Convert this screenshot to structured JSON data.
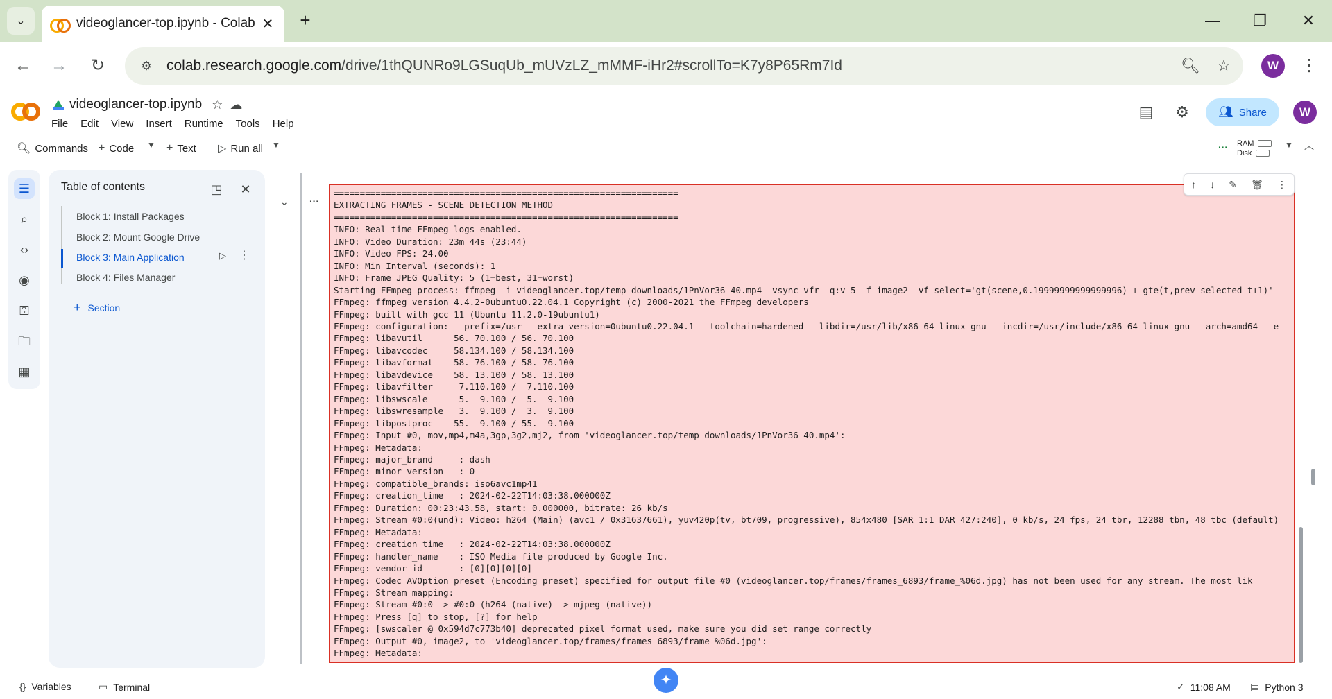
{
  "browser": {
    "tab_title": "videoglancer-top.ipynb - Colab",
    "url_host": "colab.research.google.com",
    "url_path": "/drive/1thQUNRo9LGSuqUb_mUVzLZ_mMMF-iHr2#scrollTo=K7y8P65Rm7Id",
    "profile_initial": "W"
  },
  "colab": {
    "notebook_title": "videoglancer-top.ipynb",
    "menu": [
      "File",
      "Edit",
      "View",
      "Insert",
      "Runtime",
      "Tools",
      "Help"
    ],
    "share_label": "Share",
    "avatar_initial": "W"
  },
  "cmdbar": {
    "commands_label": "Commands",
    "code_label": "Code",
    "text_label": "Text",
    "run_all_label": "Run all",
    "ram_label": "RAM",
    "disk_label": "Disk"
  },
  "toc": {
    "title": "Table of contents",
    "items": [
      {
        "label": "Block 1: Install Packages"
      },
      {
        "label": "Block 2: Mount Google Drive"
      },
      {
        "label": "Block 3: Main Application"
      },
      {
        "label": "Block 4: Files Manager"
      }
    ],
    "section_label": "Section"
  },
  "output_lines": [
    "==================================================================",
    "EXTRACTING FRAMES - SCENE DETECTION METHOD",
    "==================================================================",
    "INFO: Real-time FFmpeg logs enabled.",
    "INFO: Video Duration: 23m 44s (23:44)",
    "INFO: Video FPS: 24.00",
    "INFO: Min Interval (seconds): 1",
    "INFO: Frame JPEG Quality: 5 (1=best, 31=worst)",
    "Starting FFmpeg process: ffmpeg -i videoglancer.top/temp_downloads/1PnVor36_40.mp4 -vsync vfr -q:v 5 -f image2 -vf select='gt(scene,0.19999999999999996) + gte(t,prev_selected_t+1)'",
    "FFmpeg: ffmpeg version 4.4.2-0ubuntu0.22.04.1 Copyright (c) 2000-2021 the FFmpeg developers",
    "FFmpeg: built with gcc 11 (Ubuntu 11.2.0-19ubuntu1)",
    "FFmpeg: configuration: --prefix=/usr --extra-version=0ubuntu0.22.04.1 --toolchain=hardened --libdir=/usr/lib/x86_64-linux-gnu --incdir=/usr/include/x86_64-linux-gnu --arch=amd64 --e",
    "FFmpeg: libavutil      56. 70.100 / 56. 70.100",
    "FFmpeg: libavcodec     58.134.100 / 58.134.100",
    "FFmpeg: libavformat    58. 76.100 / 58. 76.100",
    "FFmpeg: libavdevice    58. 13.100 / 58. 13.100",
    "FFmpeg: libavfilter     7.110.100 /  7.110.100",
    "FFmpeg: libswscale      5.  9.100 /  5.  9.100",
    "FFmpeg: libswresample   3.  9.100 /  3.  9.100",
    "FFmpeg: libpostproc    55.  9.100 / 55.  9.100",
    "FFmpeg: Input #0, mov,mp4,m4a,3gp,3g2,mj2, from 'videoglancer.top/temp_downloads/1PnVor36_40.mp4':",
    "FFmpeg: Metadata:",
    "FFmpeg: major_brand     : dash",
    "FFmpeg: minor_version   : 0",
    "FFmpeg: compatible_brands: iso6avc1mp41",
    "FFmpeg: creation_time   : 2024-02-22T14:03:38.000000Z",
    "FFmpeg: Duration: 00:23:43.58, start: 0.000000, bitrate: 26 kb/s",
    "FFmpeg: Stream #0:0(und): Video: h264 (Main) (avc1 / 0x31637661), yuv420p(tv, bt709, progressive), 854x480 [SAR 1:1 DAR 427:240], 0 kb/s, 24 fps, 24 tbr, 12288 tbn, 48 tbc (default)",
    "FFmpeg: Metadata:",
    "FFmpeg: creation_time   : 2024-02-22T14:03:38.000000Z",
    "FFmpeg: handler_name    : ISO Media file produced by Google Inc.",
    "FFmpeg: vendor_id       : [0][0][0][0]",
    "FFmpeg: Codec AVOption preset (Encoding preset) specified for output file #0 (videoglancer.top/frames/frames_6893/frame_%06d.jpg) has not been used for any stream. The most lik",
    "FFmpeg: Stream mapping:",
    "FFmpeg: Stream #0:0 -> #0:0 (h264 (native) -> mjpeg (native))",
    "FFmpeg: Press [q] to stop, [?] for help",
    "FFmpeg: [swscaler @ 0x594d7c773b40] deprecated pixel format used, make sure you did set range correctly",
    "FFmpeg: Output #0, image2, to 'videoglancer.top/frames/frames_6893/frame_%06d.jpg':",
    "FFmpeg: Metadata:",
    "FFmpeg: major_brand     : dash"
  ],
  "status": {
    "variables_label": "Variables",
    "terminal_label": "Terminal",
    "time": "11:08 AM",
    "runtime": "Python 3"
  }
}
